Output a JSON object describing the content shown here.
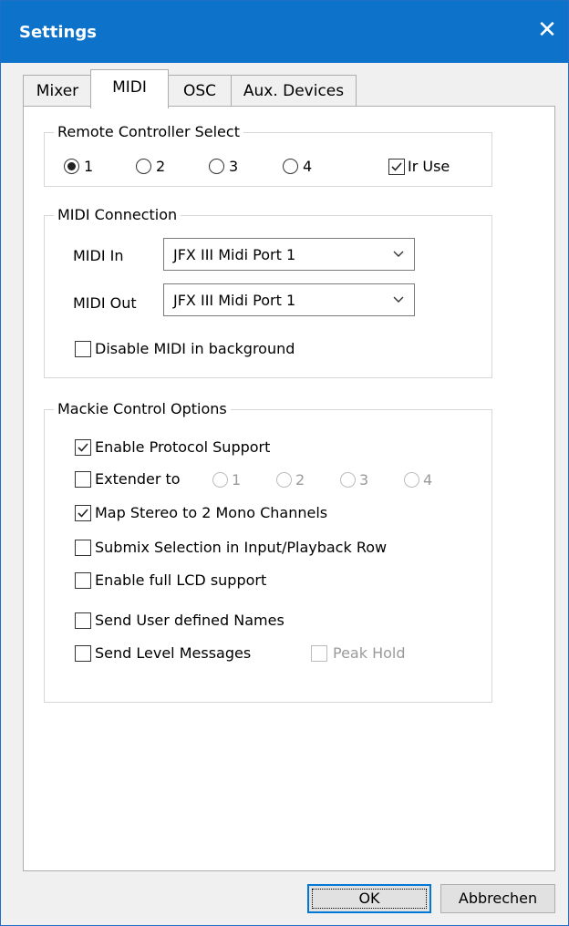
{
  "window": {
    "title": "Settings",
    "close_glyph": "✕"
  },
  "tabs": [
    {
      "label": "Mixer",
      "active": false
    },
    {
      "label": "MIDI",
      "active": true
    },
    {
      "label": "OSC",
      "active": false
    },
    {
      "label": "Aux. Devices",
      "active": false
    }
  ],
  "remote": {
    "legend": "Remote Controller Select",
    "options": [
      "1",
      "2",
      "3",
      "4"
    ],
    "selected": "1",
    "in_use": {
      "label": "Ir Use",
      "checked": true
    }
  },
  "midi": {
    "legend": "MIDI Connection",
    "in_label": "MIDI In",
    "in_value": "JFX III Midi Port 1",
    "out_label": "MIDI Out",
    "out_value": "JFX III Midi Port 1",
    "disable_bg": {
      "label": "Disable MIDI in background",
      "checked": false
    }
  },
  "mackie": {
    "legend": "Mackie Control Options",
    "enable_protocol": {
      "label": "Enable Protocol Support",
      "checked": true
    },
    "extender": {
      "label": "Extender to",
      "checked": false,
      "options": [
        "1",
        "2",
        "3",
        "4"
      ]
    },
    "map_stereo": {
      "label": "Map Stereo to 2 Mono Channels",
      "checked": true
    },
    "submix": {
      "label": "Submix Selection in Input/Playback Row",
      "checked": false
    },
    "lcd": {
      "label": "Enable full LCD support",
      "checked": false
    },
    "user_names": {
      "label": "Send User defined Names",
      "checked": false
    },
    "level_msgs": {
      "label": "Send Level Messages",
      "checked": false
    },
    "peak_hold": {
      "label": "Peak Hold",
      "checked": false,
      "enabled": false
    }
  },
  "buttons": {
    "ok": "OK",
    "cancel": "Abbrechen"
  }
}
